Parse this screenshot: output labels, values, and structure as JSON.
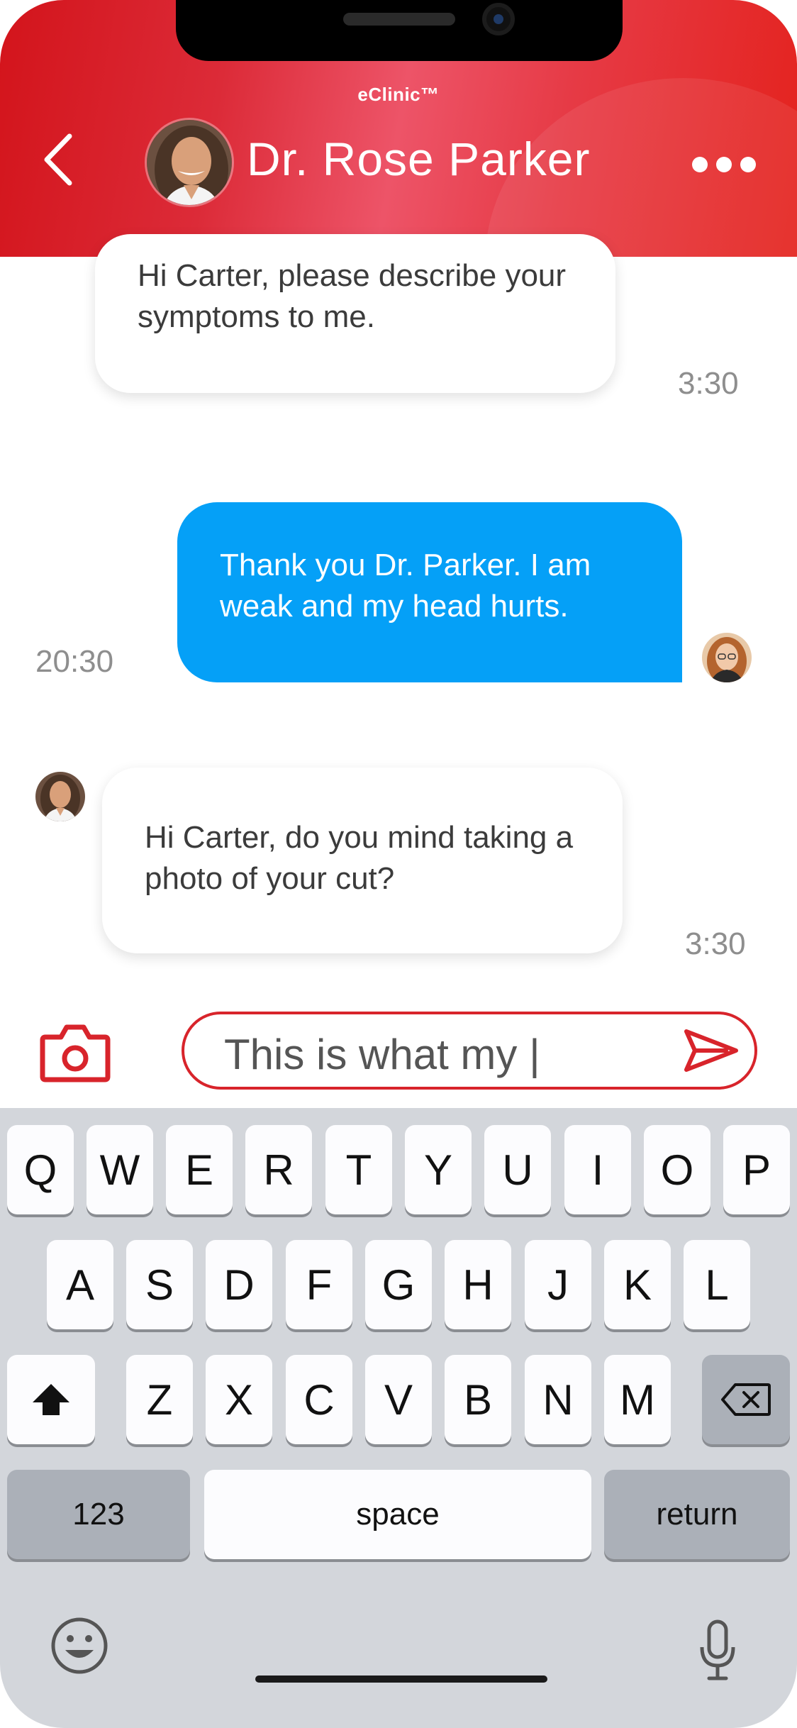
{
  "header": {
    "brand": "eClinic™",
    "doctor_name": "Dr. Rose Parker",
    "colors": {
      "start": "#d3141b",
      "mid": "#ed5468",
      "end": "#e4221d"
    }
  },
  "messages": [
    {
      "direction": "incoming",
      "text": "Hi Carter, please describe your symptoms to me.",
      "time": "3:30"
    },
    {
      "direction": "outgoing",
      "text": "Thank you Dr. Parker. I am weak and my head hurts.",
      "time": "20:30"
    },
    {
      "direction": "incoming",
      "text": "Hi Carter, do you mind taking a photo of your cut?",
      "time": "3:30"
    }
  ],
  "composer": {
    "value": "This is what my |",
    "camera_icon": "camera-icon",
    "send_icon": "send-icon",
    "accent": "#d8242b"
  },
  "keyboard": {
    "row1": [
      "Q",
      "W",
      "E",
      "R",
      "T",
      "Y",
      "U",
      "I",
      "O",
      "P"
    ],
    "row2": [
      "A",
      "S",
      "D",
      "F",
      "G",
      "H",
      "J",
      "K",
      "L"
    ],
    "row3": [
      "Z",
      "X",
      "C",
      "V",
      "B",
      "N",
      "M"
    ],
    "numbers_label": "123",
    "space_label": "space",
    "return_label": "return"
  },
  "colors": {
    "outgoing_bubble": "#05a0f7",
    "keyboard_bg": "#d3d6db"
  }
}
